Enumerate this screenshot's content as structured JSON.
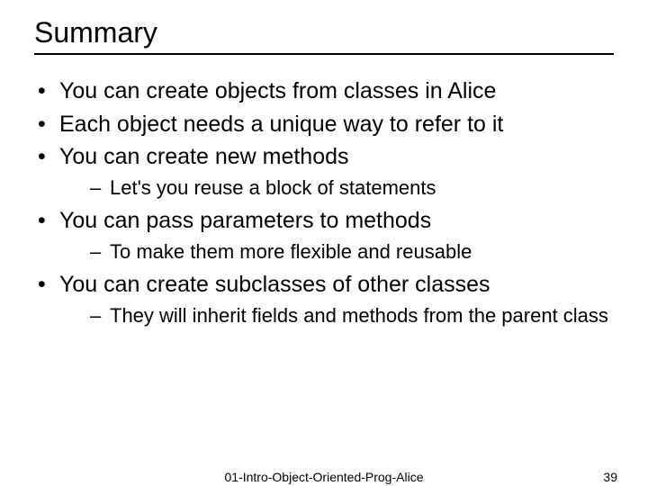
{
  "title": "Summary",
  "bullets": [
    {
      "text": "You can create objects from classes in Alice",
      "subs": []
    },
    {
      "text": "Each object needs a unique way to refer to it",
      "subs": []
    },
    {
      "text": "You can create new methods",
      "subs": [
        "Let's you reuse a block of statements"
      ]
    },
    {
      "text": "You can pass parameters to methods",
      "subs": [
        "To make them more flexible and reusable"
      ]
    },
    {
      "text": "You can create subclasses of other classes",
      "subs": [
        "They will inherit fields and methods from the parent class"
      ]
    }
  ],
  "footer": {
    "center": "01-Intro-Object-Oriented-Prog-Alice",
    "page": "39"
  }
}
